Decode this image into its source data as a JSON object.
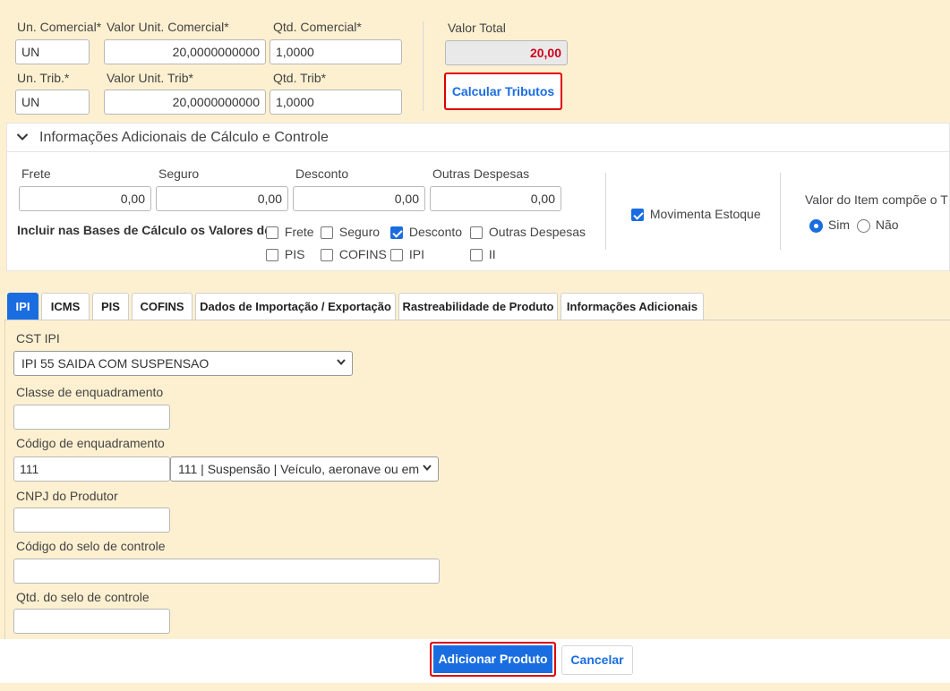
{
  "top": {
    "un_comercial_label": "Un. Comercial*",
    "un_comercial_value": "UN",
    "valor_unit_comercial_label": "Valor Unit. Comercial*",
    "valor_unit_comercial_value": "20,0000000000",
    "qtd_comercial_label": "Qtd. Comercial*",
    "qtd_comercial_value": "1,0000",
    "un_trib_label": "Un. Trib.*",
    "un_trib_value": "UN",
    "valor_unit_trib_label": "Valor Unit. Trib*",
    "valor_unit_trib_value": "20,0000000000",
    "qtd_trib_label": "Qtd. Trib*",
    "qtd_trib_value": "1,0000",
    "valor_total_label": "Valor Total",
    "valor_total_value": "20,00",
    "calcular_label": "Calcular Tributos"
  },
  "info": {
    "title": "Informações Adicionais de Cálculo e Controle",
    "frete_label": "Frete",
    "frete_value": "0,00",
    "seguro_label": "Seguro",
    "seguro_value": "0,00",
    "desconto_label": "Desconto",
    "desconto_value": "0,00",
    "outras_label": "Outras Despesas",
    "outras_value": "0,00",
    "incluir_label": "Incluir nas Bases de Cálculo os Valores de:",
    "checks": {
      "frete": {
        "label": "Frete",
        "checked": false
      },
      "seguro": {
        "label": "Seguro",
        "checked": false
      },
      "desconto": {
        "label": "Desconto",
        "checked": true
      },
      "outras": {
        "label": "Outras Despesas",
        "checked": false
      },
      "pis": {
        "label": "PIS",
        "checked": false
      },
      "cofins": {
        "label": "COFINS",
        "checked": false
      },
      "ipi": {
        "label": "IPI",
        "checked": false
      },
      "ii": {
        "label": "II",
        "checked": false
      }
    },
    "movimenta_label": "Movimenta Estoque",
    "movimenta_checked": true,
    "valor_item_label": "Valor do Item compõe o T",
    "sim_label": "Sim",
    "nao_label": "Não",
    "selected_radio": "Sim"
  },
  "tabs": {
    "ipi": "IPI",
    "icms": "ICMS",
    "pis": "PIS",
    "cofins": "COFINS",
    "importacao": "Dados de Importação / Exportação",
    "rastreabilidade": "Rastreabilidade de Produto",
    "info_adicionais": "Informações Adicionais",
    "active": "IPI"
  },
  "ipi": {
    "cst_label": "CST IPI",
    "cst_value": "IPI 55 SAIDA COM SUSPENSAO",
    "classe_label": "Classe de enquadramento",
    "classe_value": "",
    "codigo_label": "Código de enquadramento",
    "codigo_value": "111",
    "codigo_select_value": "111 | Suspensão | Veículo, aeronave ou em",
    "cnpj_label": "CNPJ do Produtor",
    "cnpj_value": "",
    "selo_label": "Código do selo de controle",
    "selo_value": "",
    "qtd_selo_label": "Qtd. do selo de controle",
    "qtd_selo_value": ""
  },
  "footer": {
    "adicionar_label": "Adicionar Produto",
    "cancelar_label": "Cancelar"
  },
  "colors": {
    "background": "#fdf0d0",
    "accent": "#1a6de0",
    "total_red": "#d0021b",
    "highlight_border": "#e00000"
  }
}
